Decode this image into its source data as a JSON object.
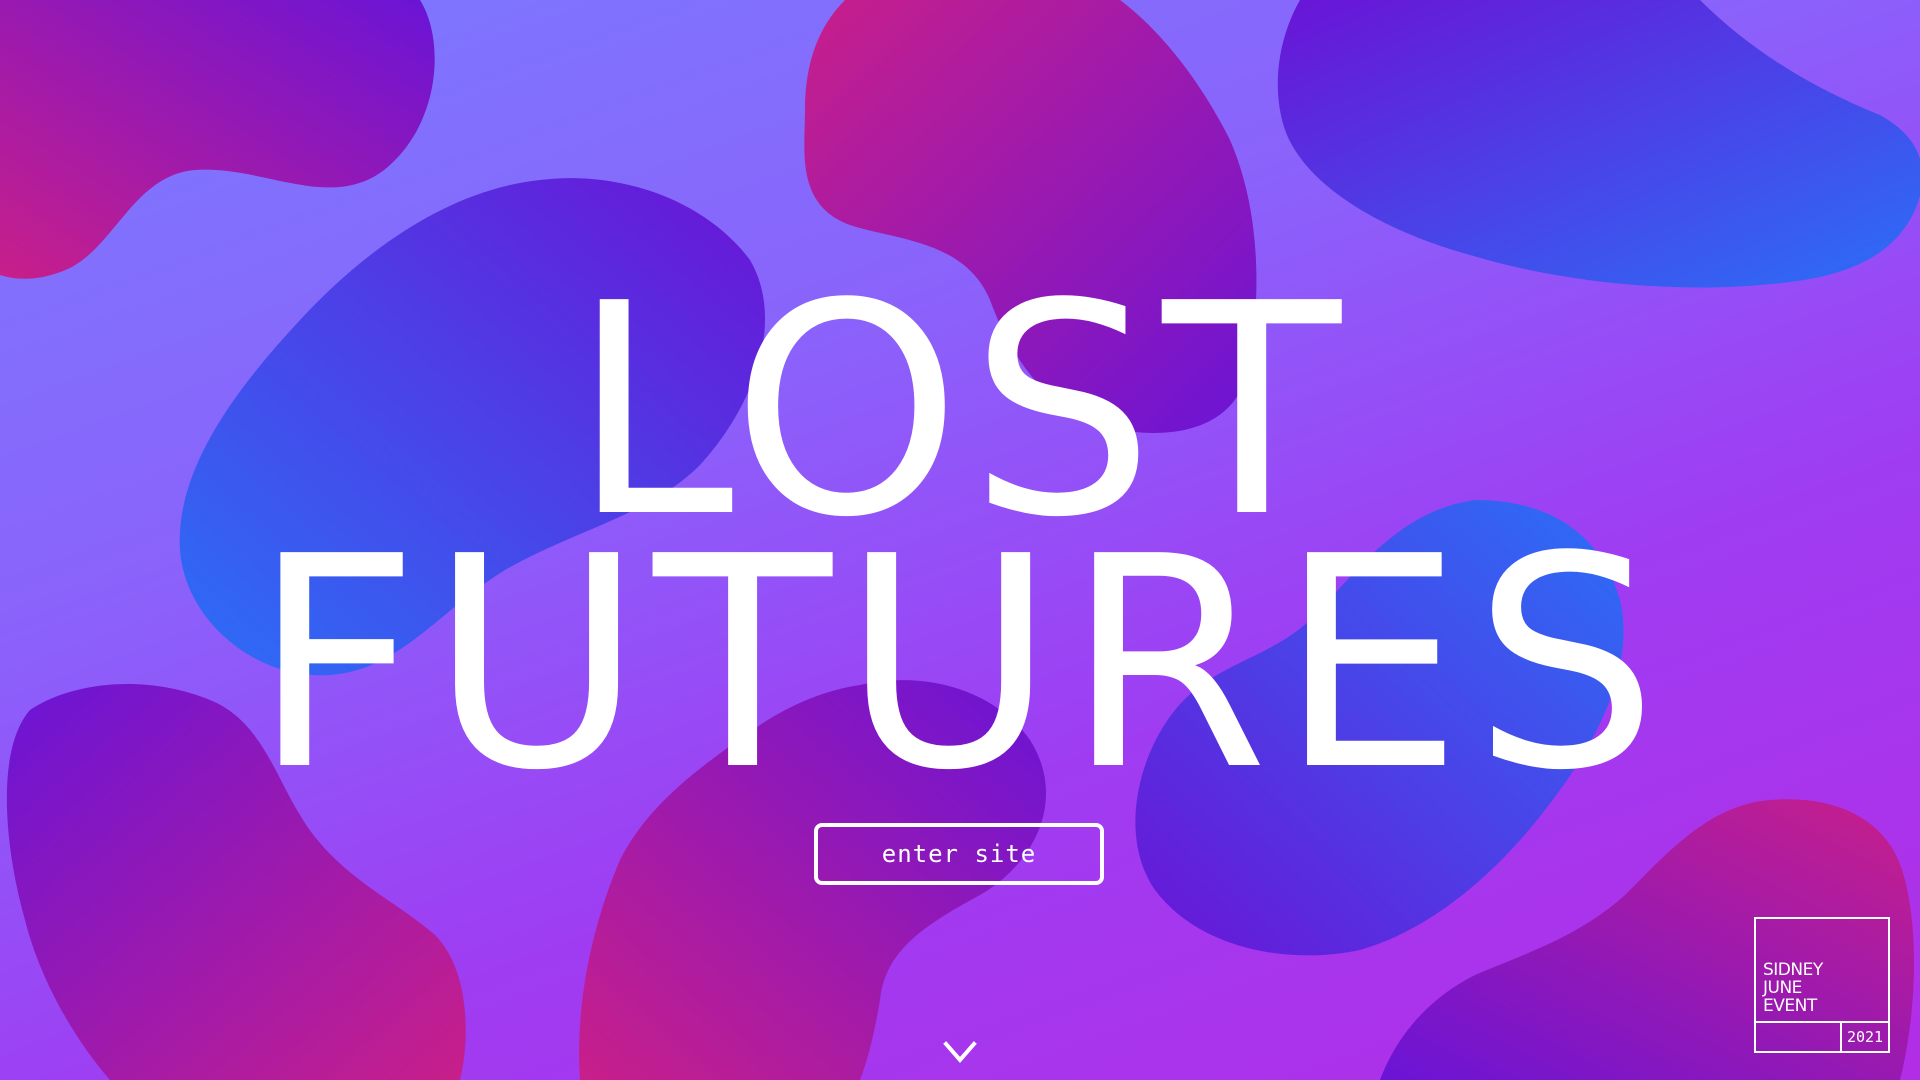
{
  "hero": {
    "title_line_1": "LOST",
    "title_line_2": "FUTURES"
  },
  "enter_button": {
    "label": "enter site"
  },
  "scroll_indicator": {
    "icon": "chevron-down-icon"
  },
  "event_badge": {
    "name_lines": [
      "SIDNEY",
      "JUNE",
      "EVENT"
    ],
    "year": "2021"
  },
  "colors": {
    "background_top": "#7a7bff",
    "background_bottom": "#b22de6",
    "blob_magenta": "#c81f8a",
    "blob_violet": "#6a14d6",
    "blob_blue": "#2b6ff7",
    "text": "#ffffff"
  }
}
